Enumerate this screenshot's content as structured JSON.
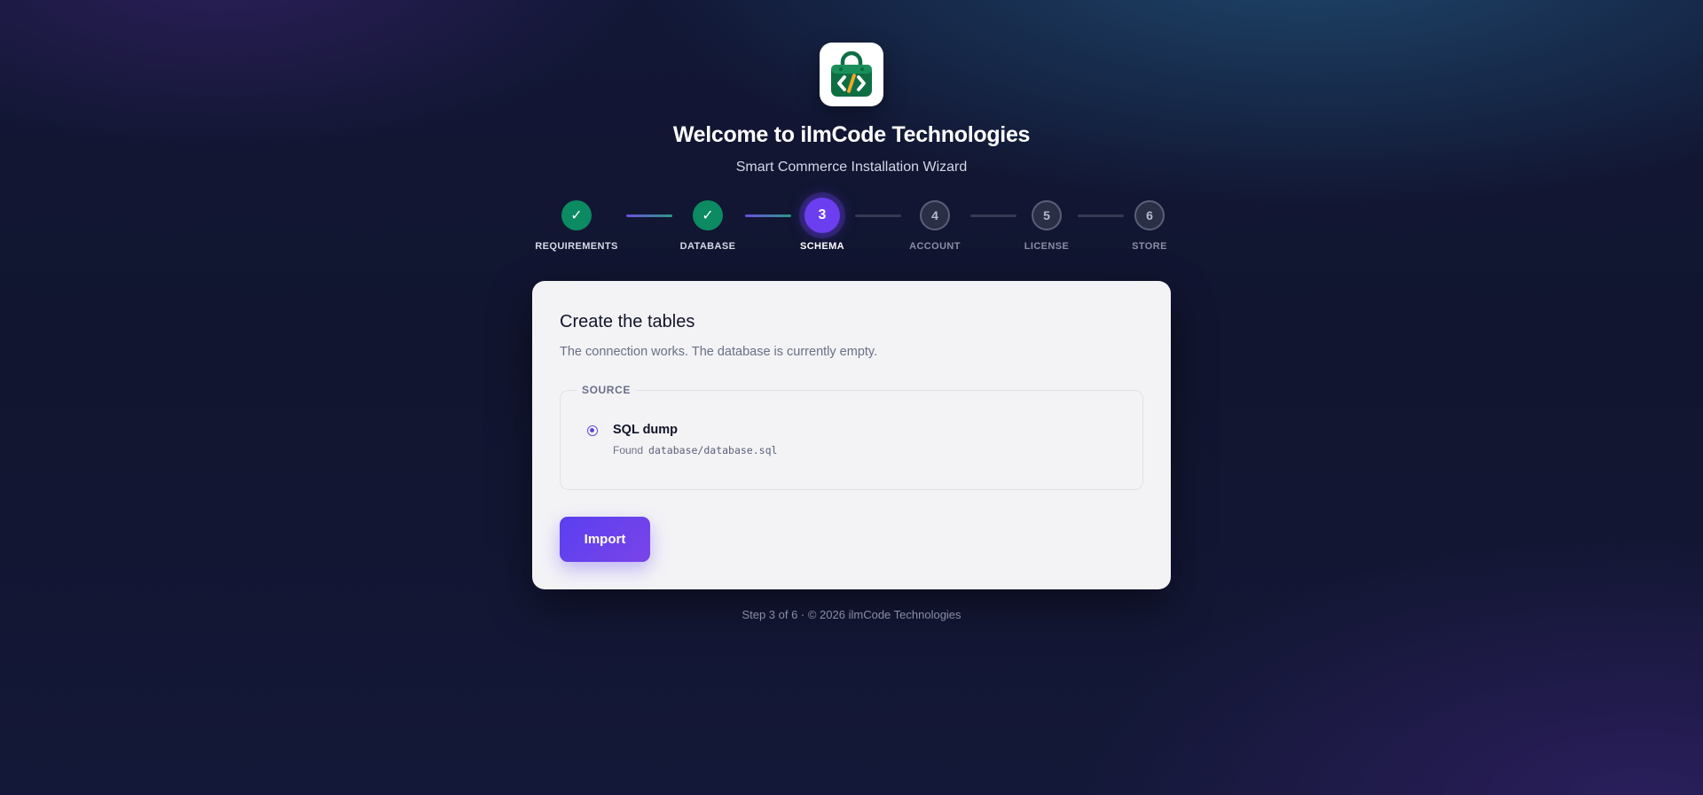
{
  "header": {
    "logo_icon": "shopping-bag-code-icon",
    "title": "Welcome to ilmCode Technologies",
    "subtitle": "Smart Commerce Installation Wizard"
  },
  "stepper": {
    "steps": [
      {
        "label": "REQUIREMENTS",
        "marker": "✓",
        "state": "done"
      },
      {
        "label": "DATABASE",
        "marker": "✓",
        "state": "done"
      },
      {
        "label": "SCHEMA",
        "marker": "3",
        "state": "active"
      },
      {
        "label": "ACCOUNT",
        "marker": "4",
        "state": "todo"
      },
      {
        "label": "LICENSE",
        "marker": "5",
        "state": "todo"
      },
      {
        "label": "STORE",
        "marker": "6",
        "state": "todo"
      }
    ]
  },
  "card": {
    "title": "Create the tables",
    "description": "The connection works. The database is currently empty.",
    "source_legend": "SOURCE",
    "option": {
      "label": "SQL dump",
      "found_prefix": "Found",
      "path": "database/database.sql",
      "selected": true
    },
    "import_label": "Import"
  },
  "footer": {
    "text": "Step 3 of 6 · © 2026 ilmCode Technologies"
  },
  "colors": {
    "accent": "#6b3ff0",
    "done": "#0c8a62",
    "card_bg": "#f3f3f6"
  }
}
